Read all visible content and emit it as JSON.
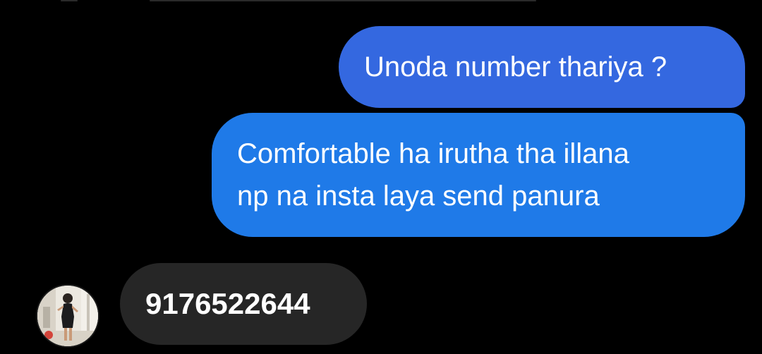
{
  "conversation": {
    "messages": [
      {
        "direction": "sent",
        "text": "Unoda number thariya ?"
      },
      {
        "direction": "sent",
        "lines": [
          "Comfortable ha irutha tha illana",
          "np na insta laya send panura"
        ]
      },
      {
        "direction": "received",
        "text": "9176522644"
      }
    ]
  },
  "colors": {
    "background": "#000000",
    "sent_bubble_top": "#3468E0",
    "sent_bubble_bottom": "#1F7AE8",
    "received_bubble": "#262626",
    "text": "#FFFFFF"
  },
  "icons": {
    "contact_avatar": "avatar-photo"
  }
}
